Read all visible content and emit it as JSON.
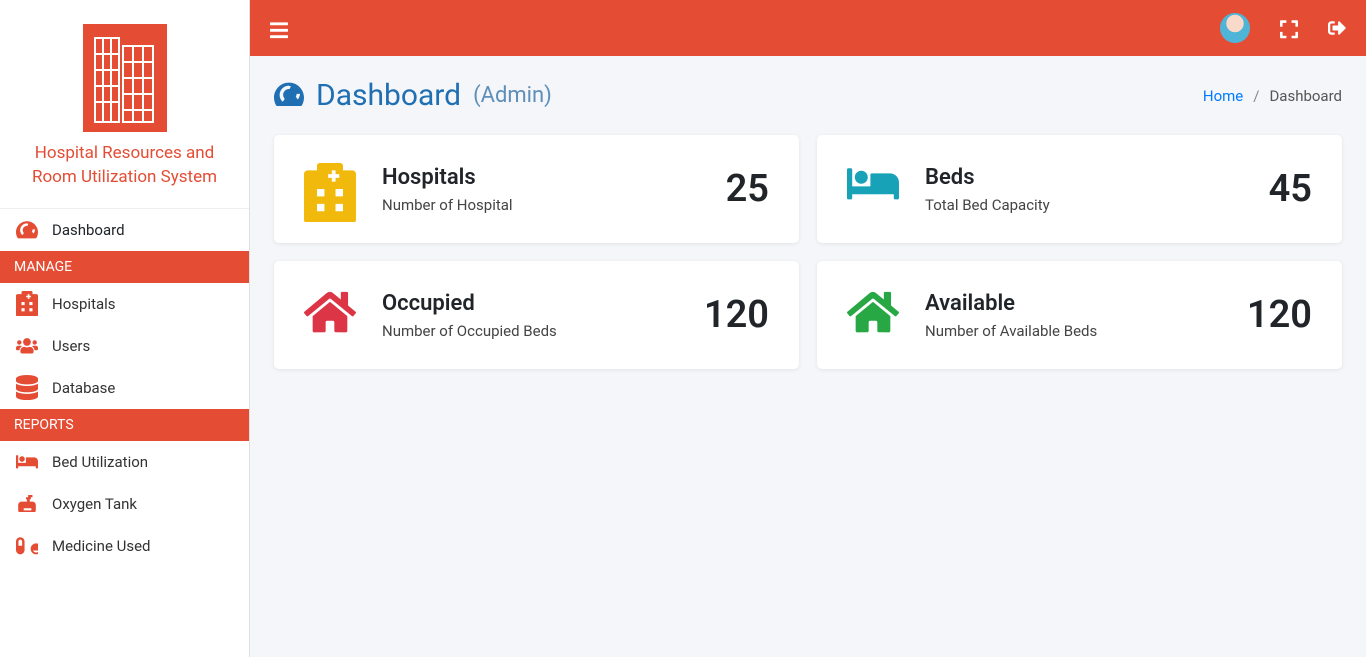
{
  "brand": {
    "name_line1": "Hospital Resources and",
    "name_line2": "Room Utilization System"
  },
  "sidebar": {
    "items": [
      {
        "label": "Dashboard",
        "icon": "gauge"
      }
    ],
    "manage_header": "MANAGE",
    "manage": [
      {
        "label": "Hospitals",
        "icon": "hospital"
      },
      {
        "label": "Users",
        "icon": "users"
      },
      {
        "label": "Database",
        "icon": "database"
      }
    ],
    "reports_header": "REPORTS",
    "reports": [
      {
        "label": "Bed Utilization",
        "icon": "bed"
      },
      {
        "label": "Oxygen Tank",
        "icon": "oxygen"
      },
      {
        "label": "Medicine Used",
        "icon": "pills"
      }
    ]
  },
  "page": {
    "title": "Dashboard",
    "subtitle": "(Admin)"
  },
  "breadcrumb": {
    "home": "Home",
    "sep": "/",
    "current": "Dashboard"
  },
  "cards": [
    {
      "title": "Hospitals",
      "subtitle": "Number of Hospital",
      "value": "25",
      "icon": "hospital",
      "color": "yellow"
    },
    {
      "title": "Beds",
      "subtitle": "Total Bed Capacity",
      "value": "45",
      "icon": "bed",
      "color": "teal"
    },
    {
      "title": "Occupied",
      "subtitle": "Number of Occupied Beds",
      "value": "120",
      "icon": "home",
      "color": "red"
    },
    {
      "title": "Available",
      "subtitle": "Number of Available Beds",
      "value": "120",
      "icon": "home",
      "color": "green"
    }
  ],
  "colors": {
    "brand": "#e44c34",
    "link": "#007bff",
    "title": "#1f6fb2"
  }
}
